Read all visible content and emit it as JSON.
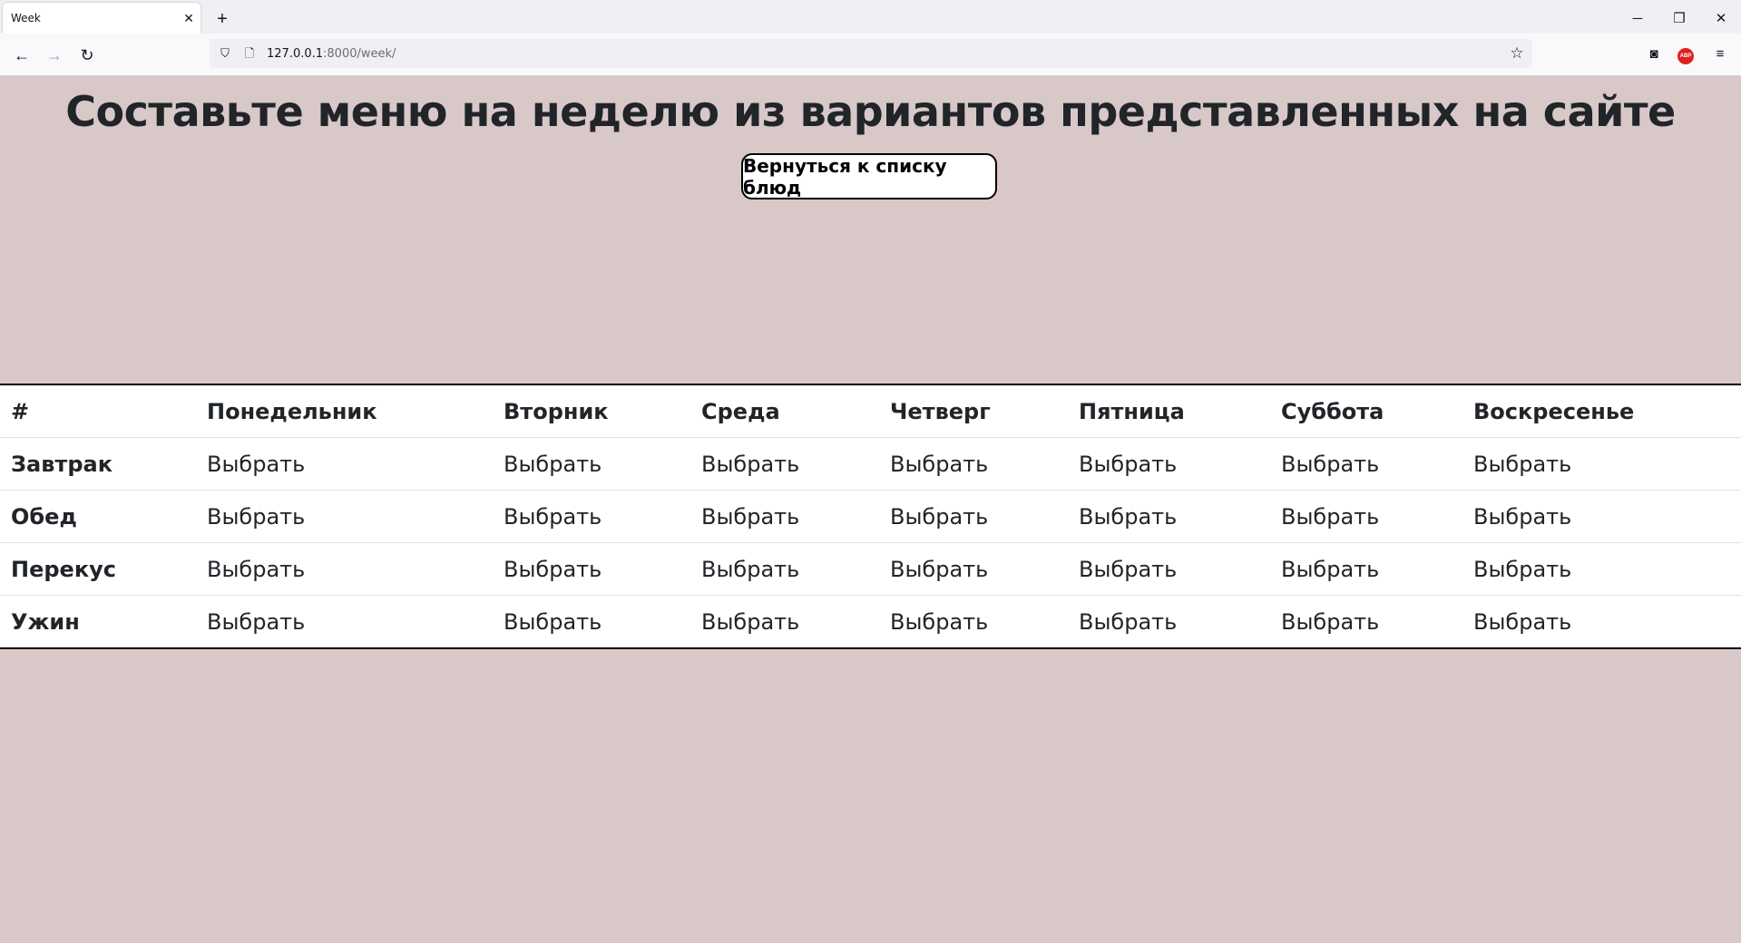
{
  "browser": {
    "tab_title": "Week",
    "url_host": "127.0.0.1",
    "url_rest": ":8000/week/"
  },
  "page": {
    "heading": "Составьте меню на неделю из вариантов представленных на сайте",
    "back_button": "Вернуться к списку блюд"
  },
  "table": {
    "headers": [
      "#",
      "Понедельник",
      "Вторник",
      "Среда",
      "Четверг",
      "Пятница",
      "Суббота",
      "Воскресенье"
    ],
    "rows": [
      {
        "meal": "Завтрак",
        "cells": [
          "Выбрать",
          "Выбрать",
          "Выбрать",
          "Выбрать",
          "Выбрать",
          "Выбрать",
          "Выбрать"
        ]
      },
      {
        "meal": "Обед",
        "cells": [
          "Выбрать",
          "Выбрать",
          "Выбрать",
          "Выбрать",
          "Выбрать",
          "Выбрать",
          "Выбрать"
        ]
      },
      {
        "meal": "Перекус",
        "cells": [
          "Выбрать",
          "Выбрать",
          "Выбрать",
          "Выбрать",
          "Выбрать",
          "Выбрать",
          "Выбрать"
        ]
      },
      {
        "meal": "Ужин",
        "cells": [
          "Выбрать",
          "Выбрать",
          "Выбрать",
          "Выбрать",
          "Выбрать",
          "Выбрать",
          "Выбрать"
        ]
      }
    ]
  },
  "colors": {
    "page_background": "#d8c8c8",
    "table_background": "#ffffff",
    "text": "#212529"
  }
}
